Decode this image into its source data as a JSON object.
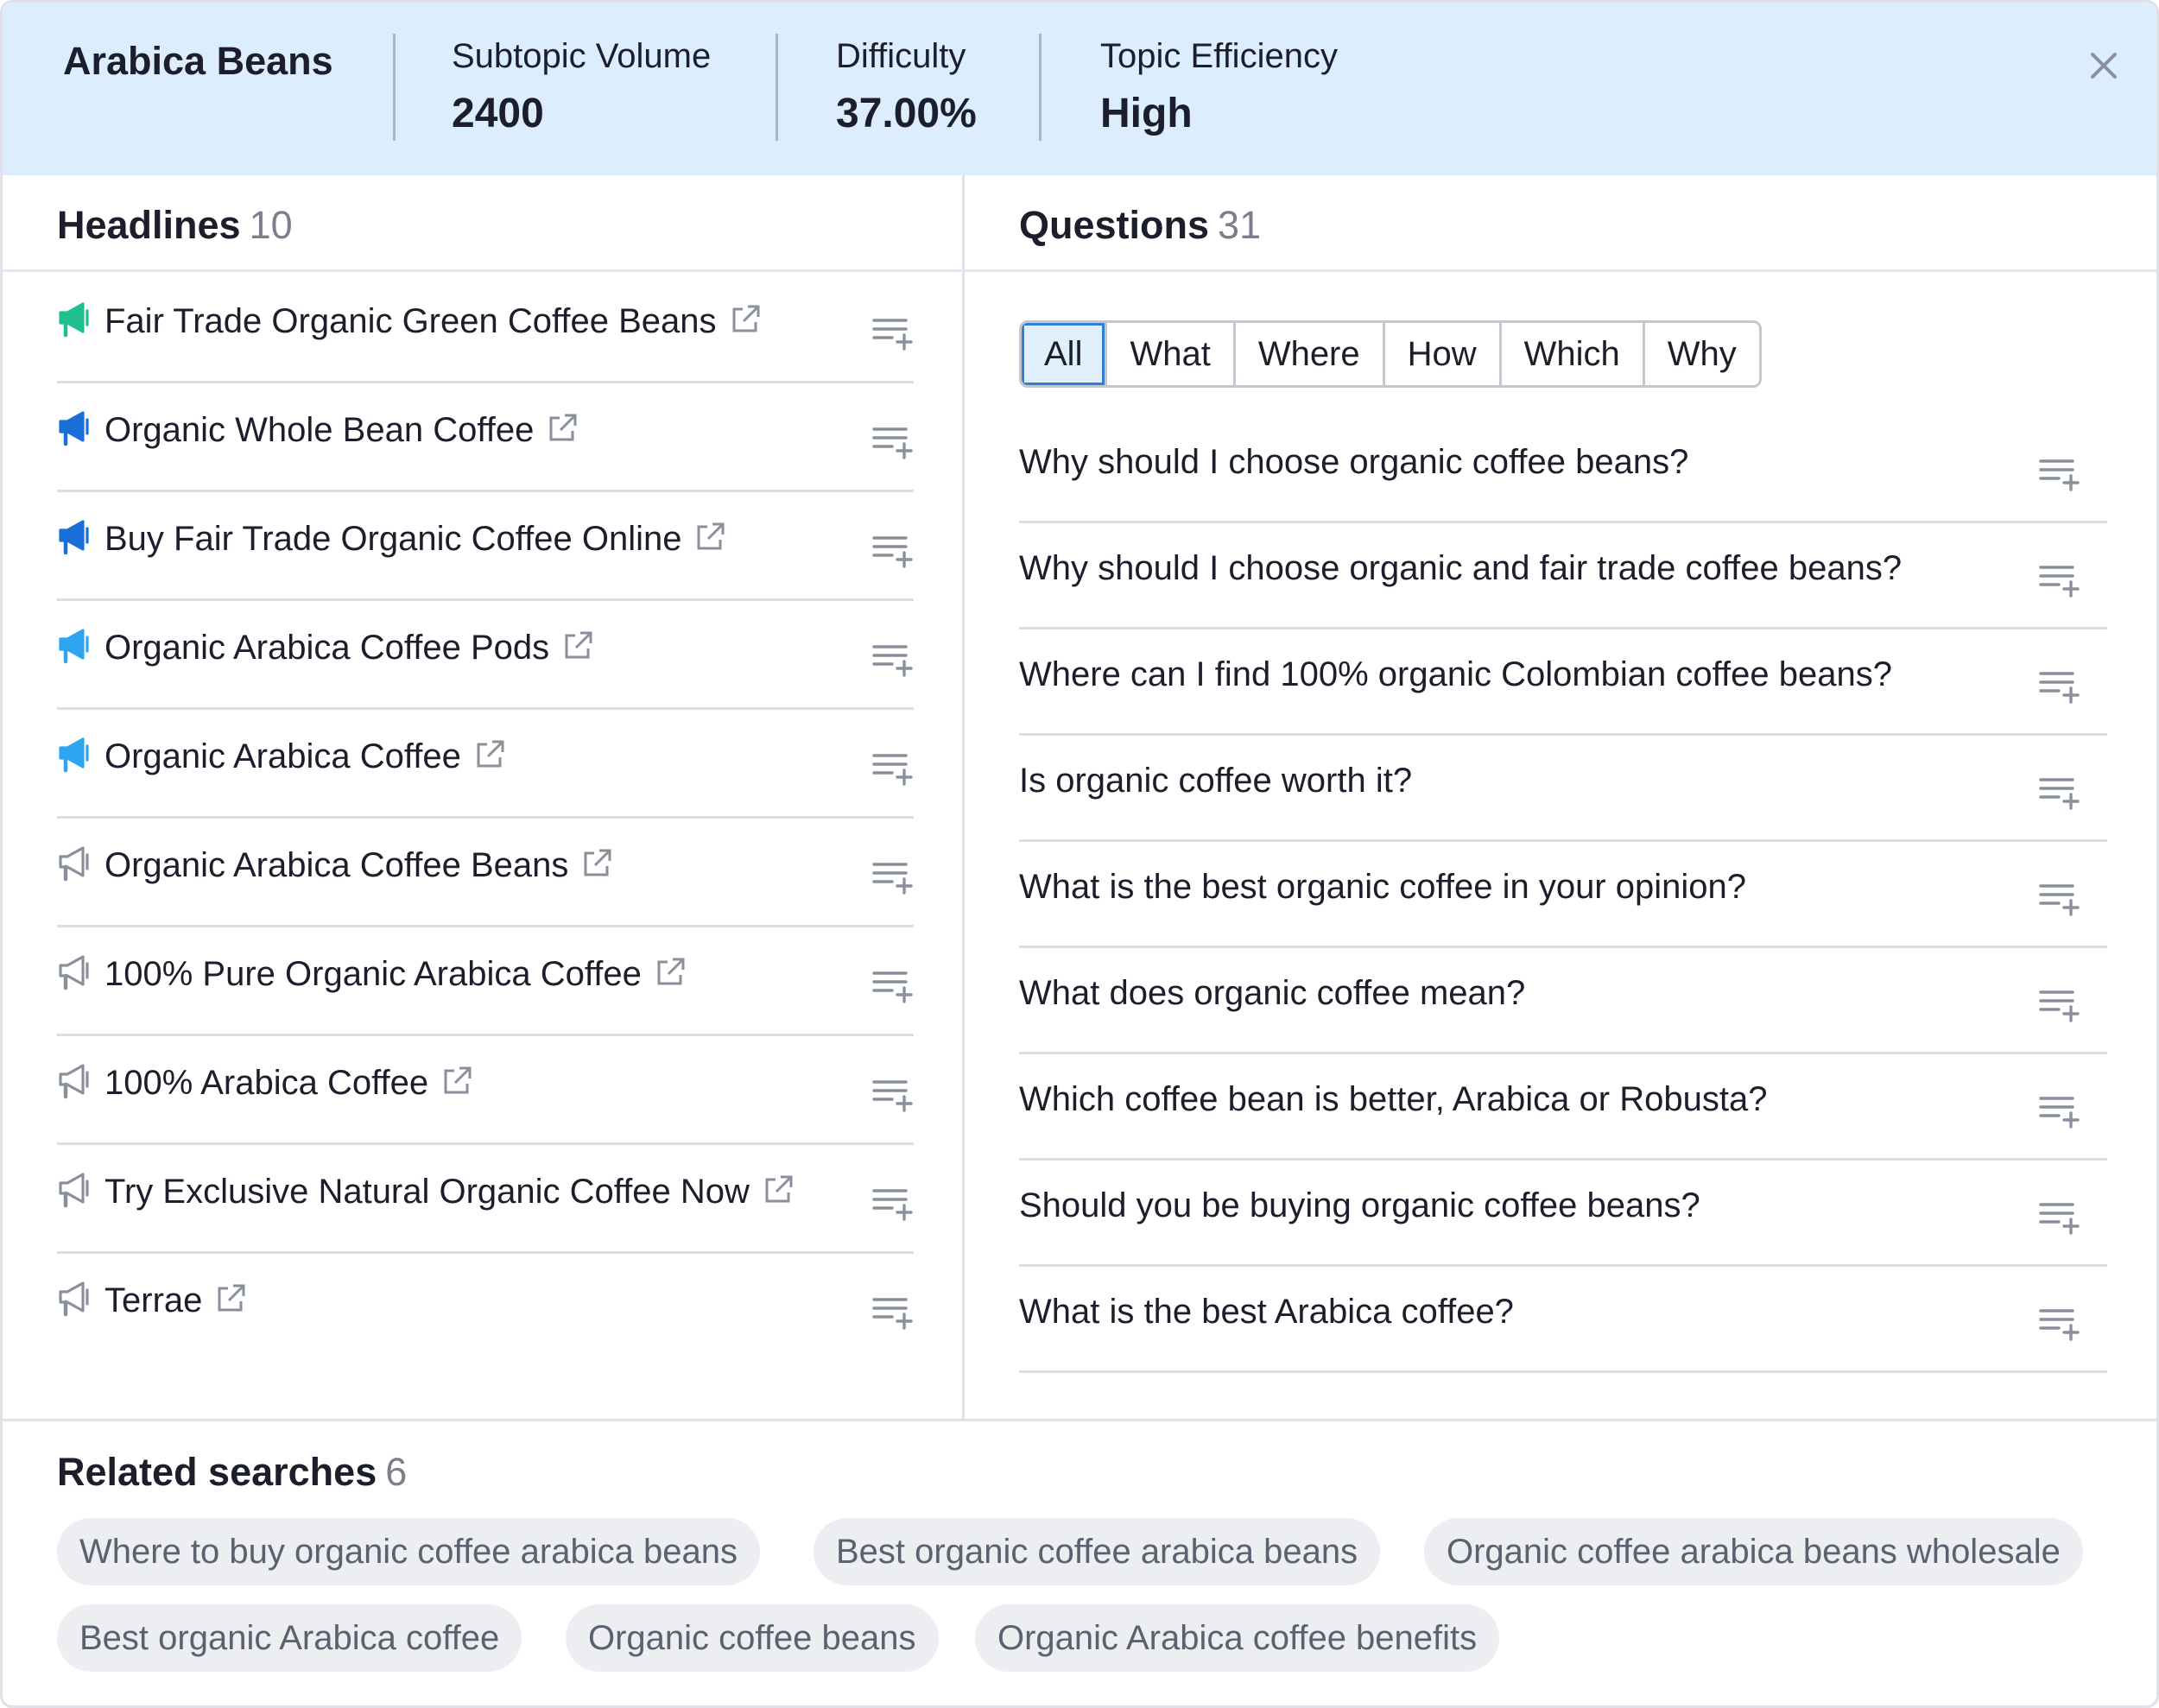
{
  "topic": {
    "title": "Arabica Beans",
    "metrics": [
      {
        "label": "Subtopic Volume",
        "value": "2400"
      },
      {
        "label": "Difficulty",
        "value": "37.00%"
      },
      {
        "label": "Topic Efficiency",
        "value": "High"
      }
    ]
  },
  "headlines": {
    "title": "Headlines",
    "count": "10",
    "items": [
      {
        "text": "Fair Trade Organic Green Coffee Beans",
        "icon": "megaphone-filled-icon",
        "color": "#1fbf8f"
      },
      {
        "text": "Organic Whole Bean Coffee",
        "icon": "megaphone-filled-icon",
        "color": "#1a6ed8"
      },
      {
        "text": "Buy Fair Trade Organic Coffee Online",
        "icon": "megaphone-filled-icon",
        "color": "#1a6ed8"
      },
      {
        "text": "Organic Arabica Coffee Pods",
        "icon": "megaphone-filled-icon",
        "color": "#2ea5f0"
      },
      {
        "text": "Organic Arabica Coffee",
        "icon": "megaphone-filled-icon",
        "color": "#2ea5f0"
      },
      {
        "text": "Organic Arabica Coffee Beans",
        "icon": "megaphone-outline-icon",
        "color": "#8a8f9c"
      },
      {
        "text": "100% Pure Organic Arabica Coffee",
        "icon": "megaphone-outline-icon",
        "color": "#8a8f9c"
      },
      {
        "text": "100% Arabica Coffee",
        "icon": "megaphone-outline-icon",
        "color": "#8a8f9c"
      },
      {
        "text": "Try Exclusive Natural Organic Coffee Now",
        "icon": "megaphone-outline-icon",
        "color": "#8a8f9c"
      },
      {
        "text": "Terrae",
        "icon": "megaphone-outline-icon",
        "color": "#8a8f9c"
      }
    ]
  },
  "questions": {
    "title": "Questions",
    "count": "31",
    "filters": [
      "All",
      "What",
      "Where",
      "How",
      "Which",
      "Why"
    ],
    "active_filter": "All",
    "items": [
      "Why should I choose organic coffee beans?",
      "Why should I choose organic and fair trade coffee beans?",
      "Where can I find 100% organic Colombian coffee beans?",
      "Is organic coffee worth it?",
      "What is the best organic coffee in your opinion?",
      "What does organic coffee mean?",
      "Which coffee bean is better, Arabica or Robusta?",
      "Should you be buying organic coffee beans?",
      "What is the best Arabica coffee?"
    ]
  },
  "related": {
    "title": "Related searches",
    "count": "6",
    "items": [
      "Where to buy organic coffee arabica beans",
      "Best organic coffee arabica beans",
      "Organic coffee arabica beans wholesale",
      "Best organic Arabica coffee",
      "Organic coffee beans",
      "Organic Arabica coffee benefits"
    ]
  },
  "icons": {
    "close": "close-icon",
    "external": "external-link-icon",
    "add_to_list": "add-to-list-icon"
  },
  "colors": {
    "header_bg": "#dceefd",
    "active_tab_border": "#2f7fd8",
    "icon_gray": "#8a8f9c"
  }
}
